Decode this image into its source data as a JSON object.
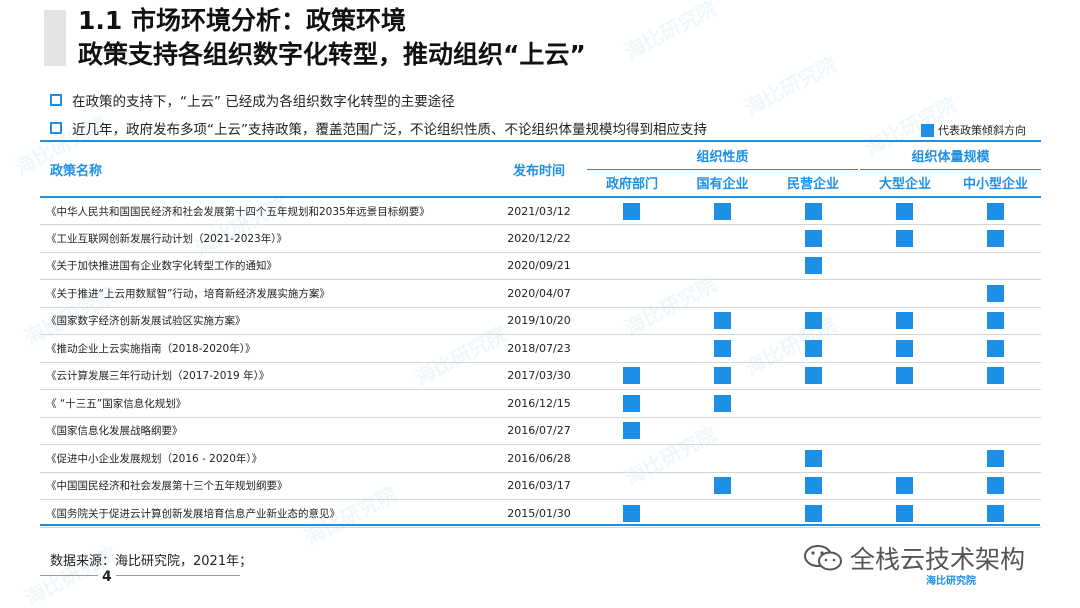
{
  "title": {
    "line1": "1.1 市场环境分析：政策环境",
    "line2": "政策支持各组织数字化转型，推动组织“上云”"
  },
  "bullets": [
    "在政策的支持下，“上云” 已经成为各组织数字化转型的主要途径",
    "近几年，政府发布多项“上云”支持政策，覆盖范围广泛，不论组织性质、不论组织体量规模均得到相应支持"
  ],
  "legend": {
    "label": "代表政策倾斜方向",
    "color": "#1e8fe6"
  },
  "table": {
    "header_name": "政策名称",
    "header_date": "发布时间",
    "group_nature": "组织性质",
    "group_scale": "组织体量规模",
    "columns": [
      "政府部门",
      "国有企业",
      "民营企业",
      "大型企业",
      "中小型企业"
    ],
    "rows": [
      {
        "name": "《中华人民共和国国民经济和社会发展第十四个五年规划和2035年远景目标纲要》",
        "date": "2021/03/12",
        "marks": [
          1,
          1,
          1,
          1,
          1
        ]
      },
      {
        "name": "《工业互联网创新发展行动计划（2021-2023年）》",
        "date": "2020/12/22",
        "marks": [
          0,
          0,
          1,
          1,
          1
        ]
      },
      {
        "name": "《关于加快推进国有企业数字化转型工作的通知》",
        "date": "2020/09/21",
        "marks": [
          0,
          0,
          1,
          0,
          0
        ]
      },
      {
        "name": "《关于推进“上云用数赋智”行动，培育新经济发展实施方案》",
        "date": "2020/04/07",
        "marks": [
          0,
          0,
          0,
          0,
          1
        ]
      },
      {
        "name": "《国家数字经济创新发展试验区实施方案》",
        "date": "2019/10/20",
        "marks": [
          0,
          1,
          1,
          1,
          1
        ]
      },
      {
        "name": "《推动企业上云实施指南（2018-2020年）》",
        "date": "2018/07/23",
        "marks": [
          0,
          1,
          1,
          1,
          1
        ]
      },
      {
        "name": "《云计算发展三年行动计划（2017-2019 年）》",
        "date": "2017/03/30",
        "marks": [
          1,
          1,
          1,
          1,
          1
        ]
      },
      {
        "name": "《 “十三五”国家信息化规划》",
        "date": "2016/12/15",
        "marks": [
          1,
          1,
          0,
          0,
          0
        ]
      },
      {
        "name": "《国家信息化发展战略纲要》",
        "date": "2016/07/27",
        "marks": [
          1,
          0,
          0,
          0,
          0
        ]
      },
      {
        "name": "《促进中小企业发展规划（2016 - 2020年）》",
        "date": "2016/06/28",
        "marks": [
          0,
          0,
          1,
          0,
          1
        ]
      },
      {
        "name": "《中国国民经济和社会发展第十三个五年规划纲要》",
        "date": "2016/03/17",
        "marks": [
          0,
          1,
          1,
          1,
          1
        ]
      },
      {
        "name": "《国务院关于促进云计算创新发展培育信息产业新业态的意见》",
        "date": "2015/01/30",
        "marks": [
          1,
          0,
          1,
          1,
          1
        ]
      }
    ]
  },
  "source": "数据来源：海比研究院，2021年；",
  "page_number": "4",
  "brand": {
    "name": "全栈云技术架构",
    "logo_text": "海比研究院",
    "icon": "wechat-icon"
  },
  "watermark": "海比研究院"
}
